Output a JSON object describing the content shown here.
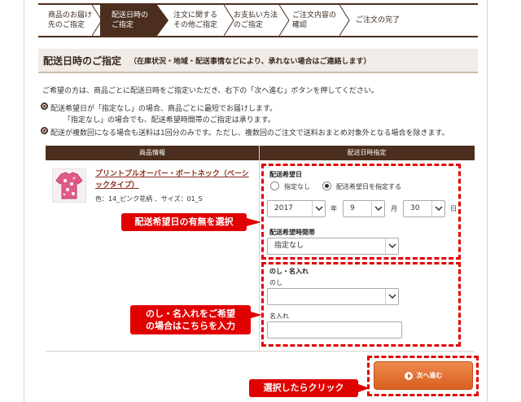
{
  "steps": [
    {
      "label": "商品のお届け\n先のご指定",
      "active": false
    },
    {
      "label": "配送日時の\nご指定",
      "active": true
    },
    {
      "label": "注文に関する\nその他ご指定",
      "active": false
    },
    {
      "label": "お支払い方法\nのご指定",
      "active": false
    },
    {
      "label": "ご注文内容の\n確認",
      "active": false
    },
    {
      "label": "ご注文の完了",
      "active": false
    }
  ],
  "section": {
    "title": "配送日時のご指定",
    "note": "（在庫状況・地域・配送事情などにより、承れない場合はご連絡します）"
  },
  "intro": "ご希望の方は、商品ごとに配送日時をご指定いただき、右下の「次へ進む」ボタンを押してください。",
  "notes": [
    "配送希望日が「指定なし」の場合、商品ごとに最短でお届けします。",
    "「指定なし」の場合でも、配送希望時間帯のご指定は承ります。",
    "配送が複数回になる場合も送料は1回分のみです。ただし、複数回のご注文で送料おまとめ対象外となる場合を除きます。"
  ],
  "table": {
    "col_product": "商品情報",
    "col_delivery": "配送日時指定"
  },
  "product": {
    "name": "プリントプルオーバー・ボートネック（ベーシックタイプ）",
    "meta": "色：14_ピンク花柄 、サイズ：01_S"
  },
  "delivery": {
    "date_label": "配送希望日",
    "radio_none": "指定なし",
    "radio_specify": "配送希望日を指定する",
    "year": "2017",
    "year_unit": "年",
    "month": "9",
    "month_unit": "月",
    "day": "30",
    "day_unit": "日",
    "time_label": "配送希望時間帯",
    "time_value": "指定なし"
  },
  "noshi": {
    "section_label": "のし・名入れ",
    "noshi_label": "のし",
    "noshi_value": "",
    "name_label": "名入れ",
    "name_value": ""
  },
  "callouts": {
    "date": "配送希望日の有無を選択",
    "noshi": "のし・名入れをご希望\nの場合はこちらを入力",
    "click": "選択したらクリック"
  },
  "next_button": "次へ進む",
  "colors": {
    "brand_brown": "#4b2e1e",
    "accent_red": "#e00000",
    "button_orange": "#e0702f"
  }
}
